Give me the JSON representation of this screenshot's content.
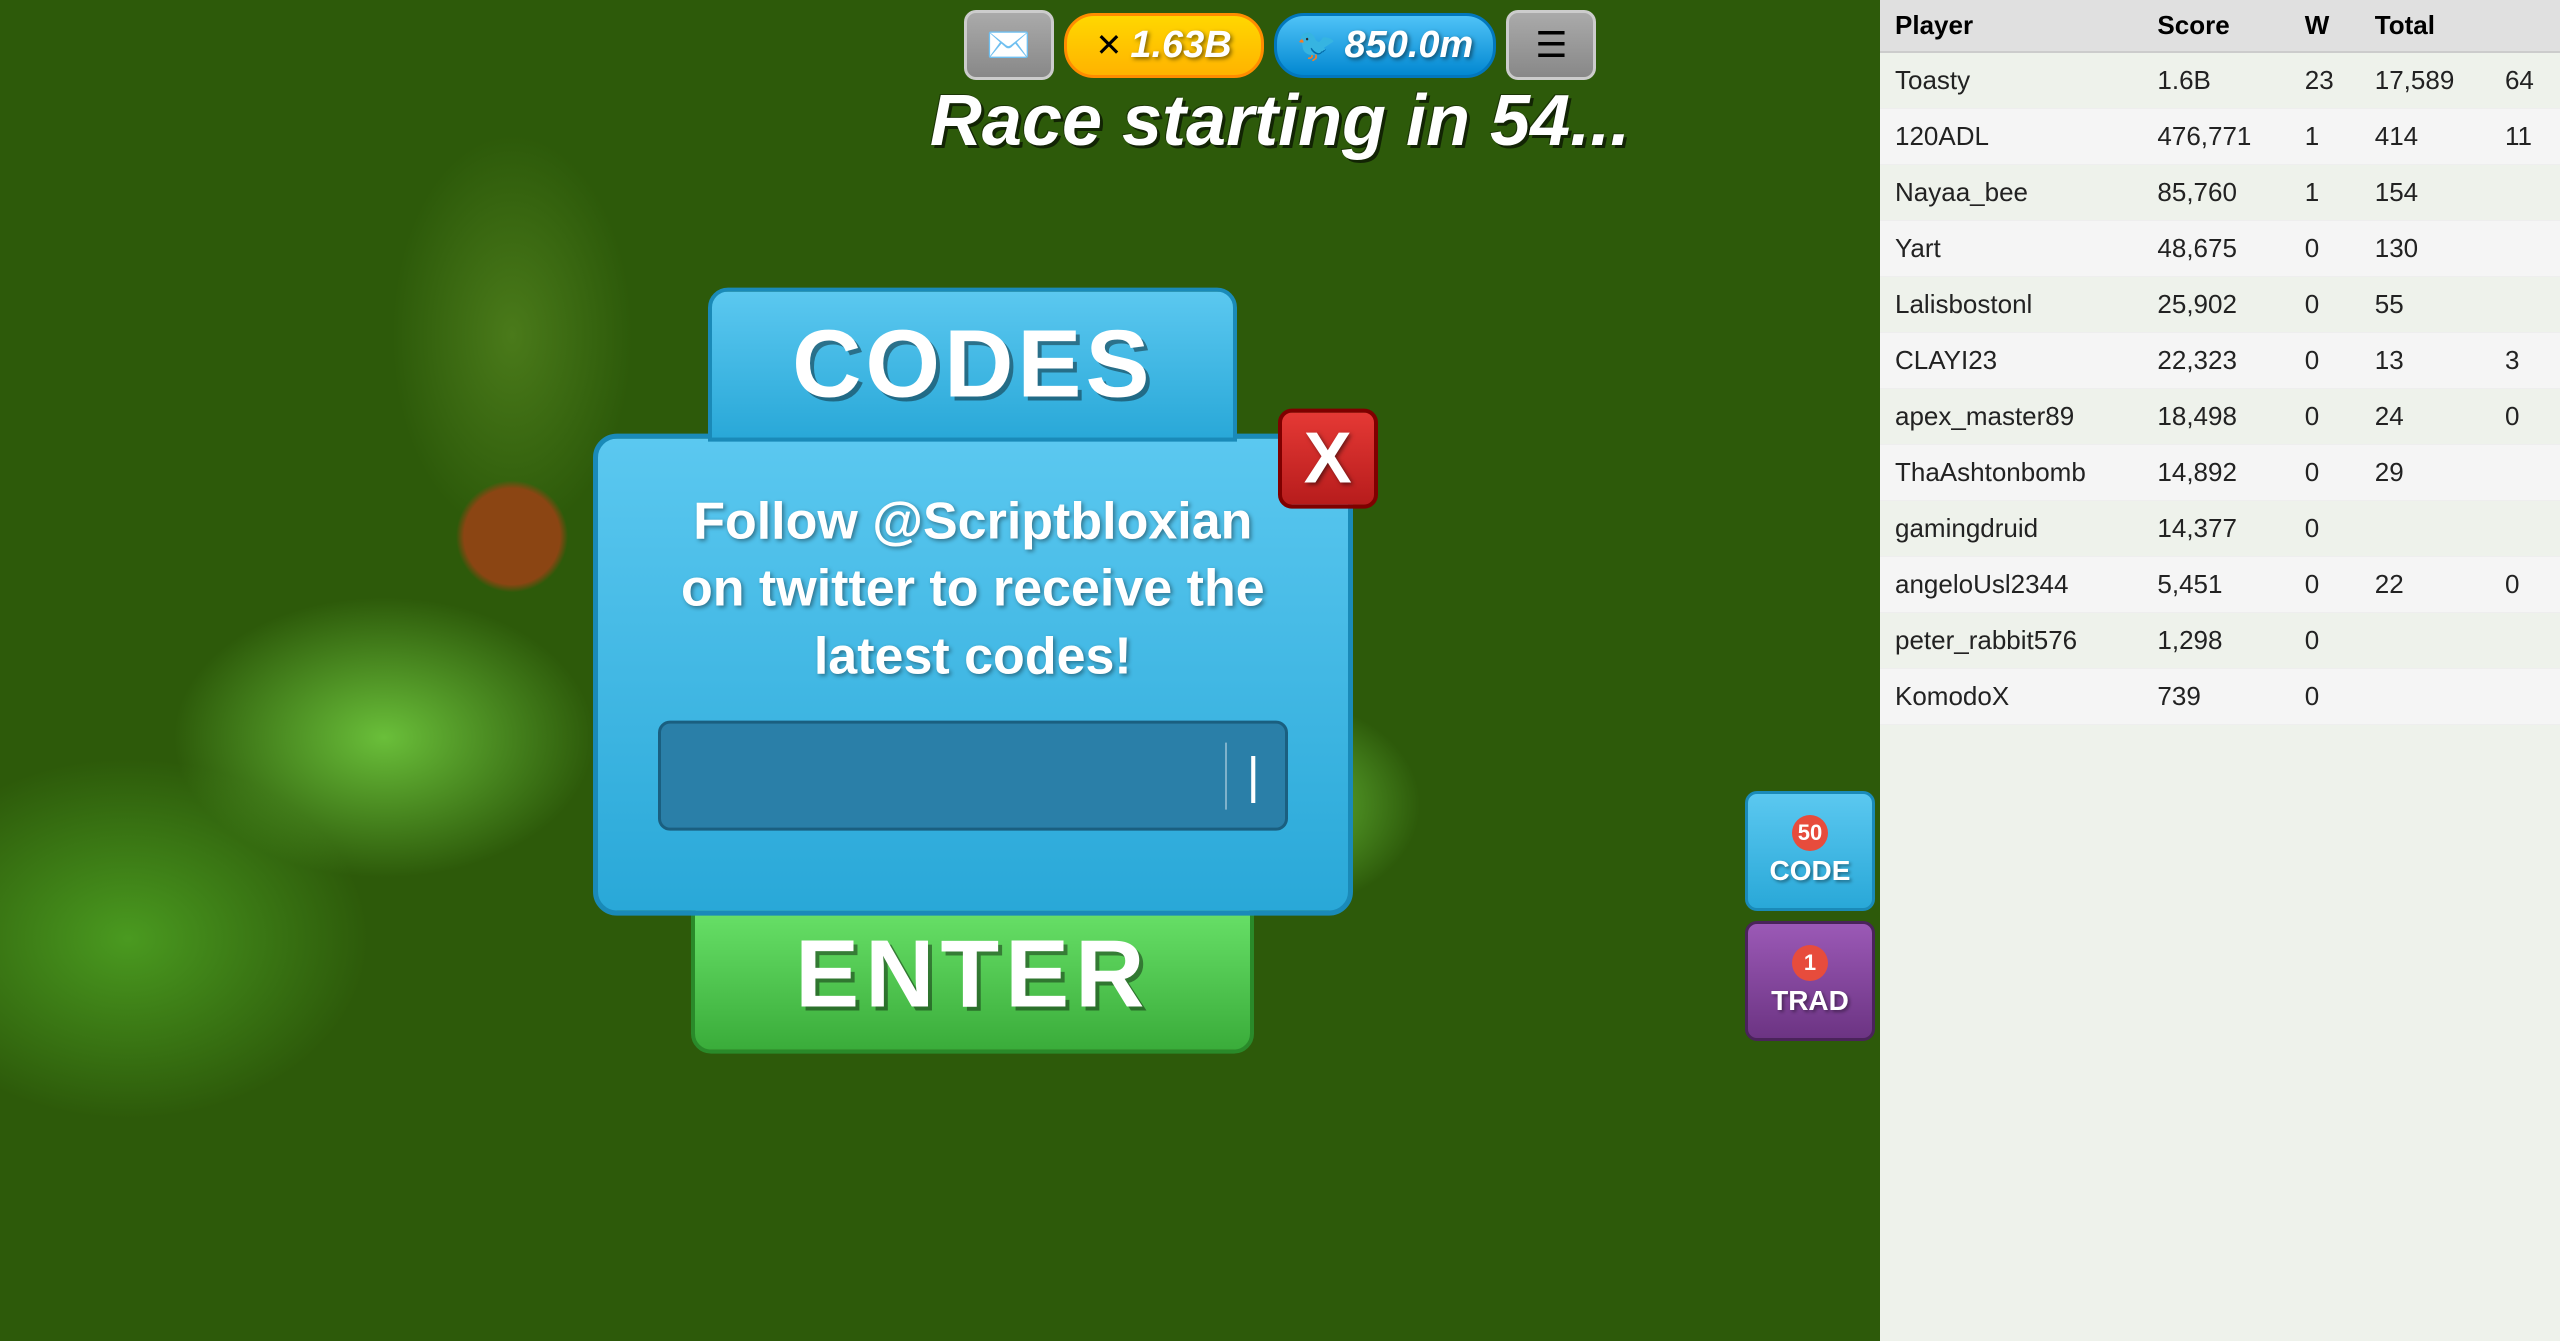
{
  "game": {
    "race_text": "Race starting in 54...",
    "currency_gold": "1.63B",
    "currency_blue": "850.0m"
  },
  "codes_modal": {
    "title": "CODES",
    "follow_text": "Follow @Scriptbloxian on twitter to receive the latest codes!",
    "input_placeholder": "",
    "close_label": "X",
    "enter_label": "ENTER"
  },
  "leaderboard": {
    "columns": [
      "Player",
      "Score",
      "Wins",
      "Total",
      "?"
    ],
    "rows": [
      {
        "player": "Toasty",
        "score": "1.6B",
        "wins": "23",
        "total": "17,589",
        "extra": "64"
      },
      {
        "player": "120ADL",
        "score": "476,771",
        "wins": "1",
        "total": "414",
        "extra": "11"
      },
      {
        "player": "Nayaa_bee",
        "score": "85,760",
        "wins": "1",
        "total": "154",
        "extra": ""
      },
      {
        "player": "Yart",
        "score": "48,675",
        "wins": "0",
        "total": "130",
        "extra": ""
      },
      {
        "player": "Lalisbostonl",
        "score": "25,902",
        "wins": "0",
        "total": "55",
        "extra": ""
      },
      {
        "player": "CLAYI23",
        "score": "22,323",
        "wins": "0",
        "total": "13",
        "extra": "3"
      },
      {
        "player": "apex_master89",
        "score": "18,498",
        "wins": "0",
        "total": "24",
        "extra": "0"
      },
      {
        "player": "ThaAshtonbomb",
        "score": "14,892",
        "wins": "0",
        "total": "29",
        "extra": ""
      },
      {
        "player": "gamingdruid",
        "score": "14,377",
        "wins": "0",
        "total": "",
        "extra": ""
      },
      {
        "player": "angeloUsl2344",
        "score": "5,451",
        "wins": "0",
        "total": "22",
        "extra": "0"
      },
      {
        "player": "peter_rabbit576",
        "score": "1,298",
        "wins": "0",
        "total": "",
        "extra": ""
      },
      {
        "player": "KomodoX",
        "score": "739",
        "wins": "0",
        "total": "",
        "extra": ""
      }
    ]
  },
  "side_buttons": {
    "codes_label": "CODE",
    "codes_number": "50",
    "trade_label": "TRAD",
    "trade_number": "1"
  }
}
